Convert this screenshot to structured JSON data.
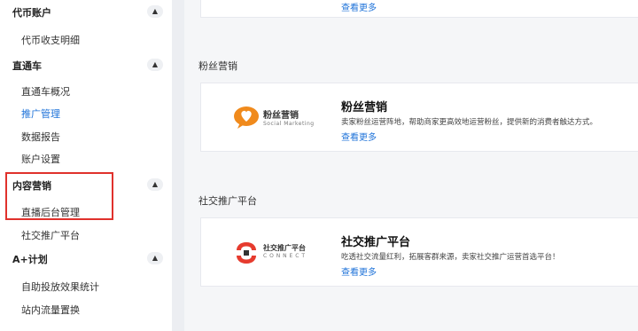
{
  "sidebar": {
    "groups": [
      {
        "title": "代币账户",
        "toggle": "▲",
        "items": [
          "代币收支明细"
        ]
      },
      {
        "title": "直通车",
        "toggle": "▲",
        "items": [
          "直通车概况",
          "推广管理",
          "数据报告",
          "账户设置"
        ]
      },
      {
        "title": "内容营销",
        "toggle": "▲",
        "items": [
          "直播后台管理",
          "社交推广平台"
        ]
      },
      {
        "title": "A+计划",
        "toggle": "▲",
        "items": [
          "自助投放效果统计",
          "站内流量置换"
        ]
      }
    ]
  },
  "main": {
    "top_card": {
      "link": "查看更多"
    },
    "sections": [
      {
        "label": "粉丝营销",
        "card": {
          "logo_main": "粉丝营销",
          "logo_sub": "Social Marketing",
          "title": "粉丝营销",
          "desc": "卖家粉丝运营阵地，帮助商家更高效地运营粉丝，提供新的消费者触达方式。",
          "link": "查看更多"
        }
      },
      {
        "label": "社交推广平台",
        "card": {
          "logo_main": "社交推广平台",
          "logo_sub": "C O N N E C T",
          "title": "社交推广平台",
          "desc": "吃透社交流量红利，拓展客群来源，卖家社交推广运营首选平台！",
          "link": "查看更多"
        }
      }
    ]
  },
  "colors": {
    "accent": "#1f73d9",
    "highlight": "#e0312c",
    "logo_orange": "#f08a1c",
    "logo_red": "#e63b2e"
  }
}
